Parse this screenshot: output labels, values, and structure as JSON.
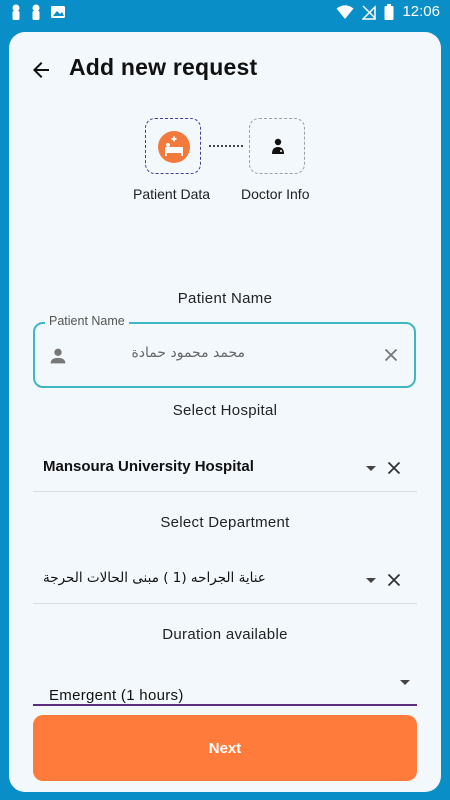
{
  "status_bar": {
    "time": "12:06",
    "icons_left": [
      "notification-icon",
      "notification-icon",
      "image-icon"
    ],
    "icons_right": [
      "wifi-icon",
      "no-signal-icon",
      "battery-icon"
    ]
  },
  "header": {
    "title": "Add new request"
  },
  "stepper": {
    "steps": [
      {
        "label": "Patient Data",
        "icon": "patient-bed-icon",
        "active": true
      },
      {
        "label": "Doctor Info",
        "icon": "doctor-icon",
        "active": false
      }
    ]
  },
  "patient_name": {
    "section_label": "Patient Name",
    "field_label": "Patient Name",
    "value": "محمد محمود حمادة"
  },
  "hospital": {
    "section_label": "Select Hospital",
    "value": "Mansoura University Hospital"
  },
  "department": {
    "section_label": "Select Department",
    "value": "عناية الجراحه (1 ) مبنى الحالات الحرجة"
  },
  "duration": {
    "section_label": "Duration available",
    "value": "Emergent (1 hours)"
  },
  "next_button": {
    "label": "Next"
  },
  "colors": {
    "accent": "#ff7b3c",
    "field_border": "#3fb6c3",
    "background": "#0a8ec7"
  }
}
